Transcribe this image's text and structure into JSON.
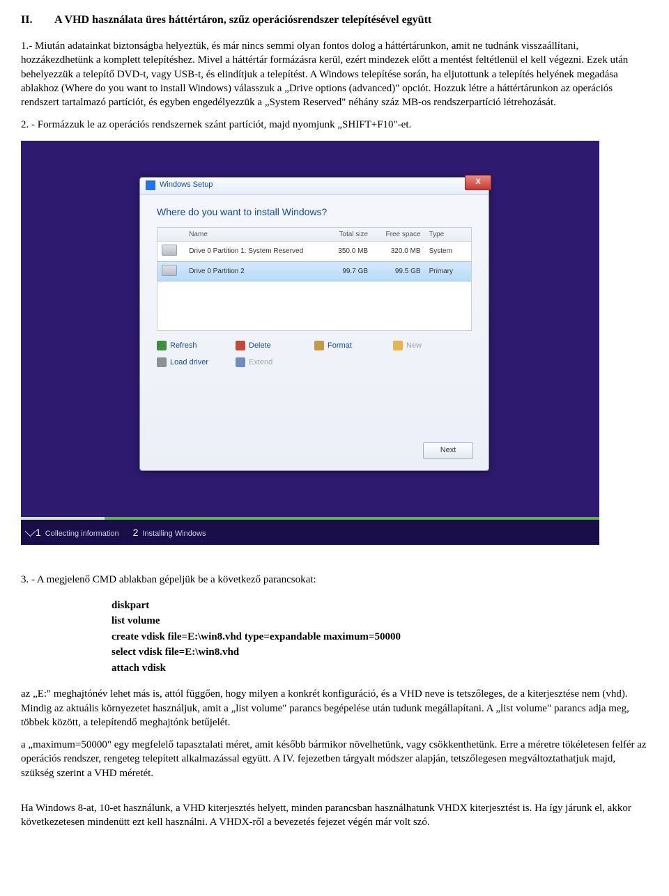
{
  "heading": {
    "num": "II.",
    "text": "A VHD használata üres háttértáron, szűz operációsrendszer telepítésével együtt"
  },
  "p1": "1.- Miután adatainkat biztonságba helyeztük, és már nincs semmi olyan fontos dolog a háttértárunkon, amit ne tudnánk visszaállítani, hozzákezdhetünk a komplett telepítéshez. Mivel a háttértár formázásra kerül, ezért mindezek előtt a mentést feltétlenül el kell végezni. Ezek után behelyezzük a telepítő DVD-t, vagy USB-t, és elindítjuk a telepítést. A Windows telepítése során, ha eljutottunk a telepítés helyének megadása ablakhoz (Where do you want to install Windows) válasszuk a „Drive options (advanced)\" opciót. Hozzuk létre a háttértárunkon az operációs rendszert tartalmazó partíciót, és egyben engedélyezzük a „System Reserved\" néhány száz MB-os rendszerpartíció létrehozását.",
  "p2": "2. - Formázzuk le az operációs rendszernek szánt partíciót, majd nyomjunk „SHIFT+F10\"-et.",
  "setup": {
    "title": "Windows Setup",
    "close": "X",
    "question": "Where do you want to install Windows?",
    "headers": {
      "name": "Name",
      "total": "Total size",
      "free": "Free space",
      "type": "Type"
    },
    "rows": [
      {
        "name": "Drive 0 Partition 1: System Reserved",
        "total": "350.0 MB",
        "free": "320.0 MB",
        "type": "System"
      },
      {
        "name": "Drive 0 Partition 2",
        "total": "99.7 GB",
        "free": "99.5 GB",
        "type": "Primary"
      }
    ],
    "actions": {
      "refresh": "Refresh",
      "delete": "Delete",
      "format": "Format",
      "new": "New",
      "load": "Load driver",
      "extend": "Extend"
    },
    "next": "Next",
    "steps": {
      "s1": "Collecting information",
      "s2": "Installing Windows"
    }
  },
  "p3": "3. - A megjelenő CMD ablakban gépeljük be a következő parancsokat:",
  "cmds": {
    "c1": "diskpart",
    "c2": "list volume",
    "c3": "create vdisk file=E:\\win8.vhd   type=expandable   maximum=50000",
    "c4": "select  vdisk  file=E:\\win8.vhd",
    "c5": "attach  vdisk"
  },
  "p4": "az „E:\" meghajtónév lehet más is, attól függően, hogy milyen a konkrét konfiguráció, és a VHD neve is tetszőleges, de a kiterjesztése nem (vhd). Mindig az aktuális környezetet használjuk, amit a „list volume\" parancs begépelése után tudunk megállapítani. A „list volume\" parancs adja meg, többek között, a telepítendő meghajtónk betűjelét.",
  "p5": "a „maximum=50000\" egy megfelelő tapasztalati méret, amit később bármikor növelhetünk, vagy csökkenthetünk. Erre a méretre tökéletesen felfér az operációs rendszer, rengeteg telepített alkalmazással együtt. A IV. fejezetben tárgyalt módszer alapján, tetszőlegesen megváltoztathatjuk majd, szükség szerint a VHD méretét.",
  "p6": "Ha Windows 8-at, 10-et használunk, a VHD kiterjesztés helyett, minden parancsban használhatunk VHDX kiterjesztést is. Ha így járunk el, akkor következetesen mindenütt ezt kell használni. A VHDX-ről a bevezetés fejezet végén már volt szó."
}
